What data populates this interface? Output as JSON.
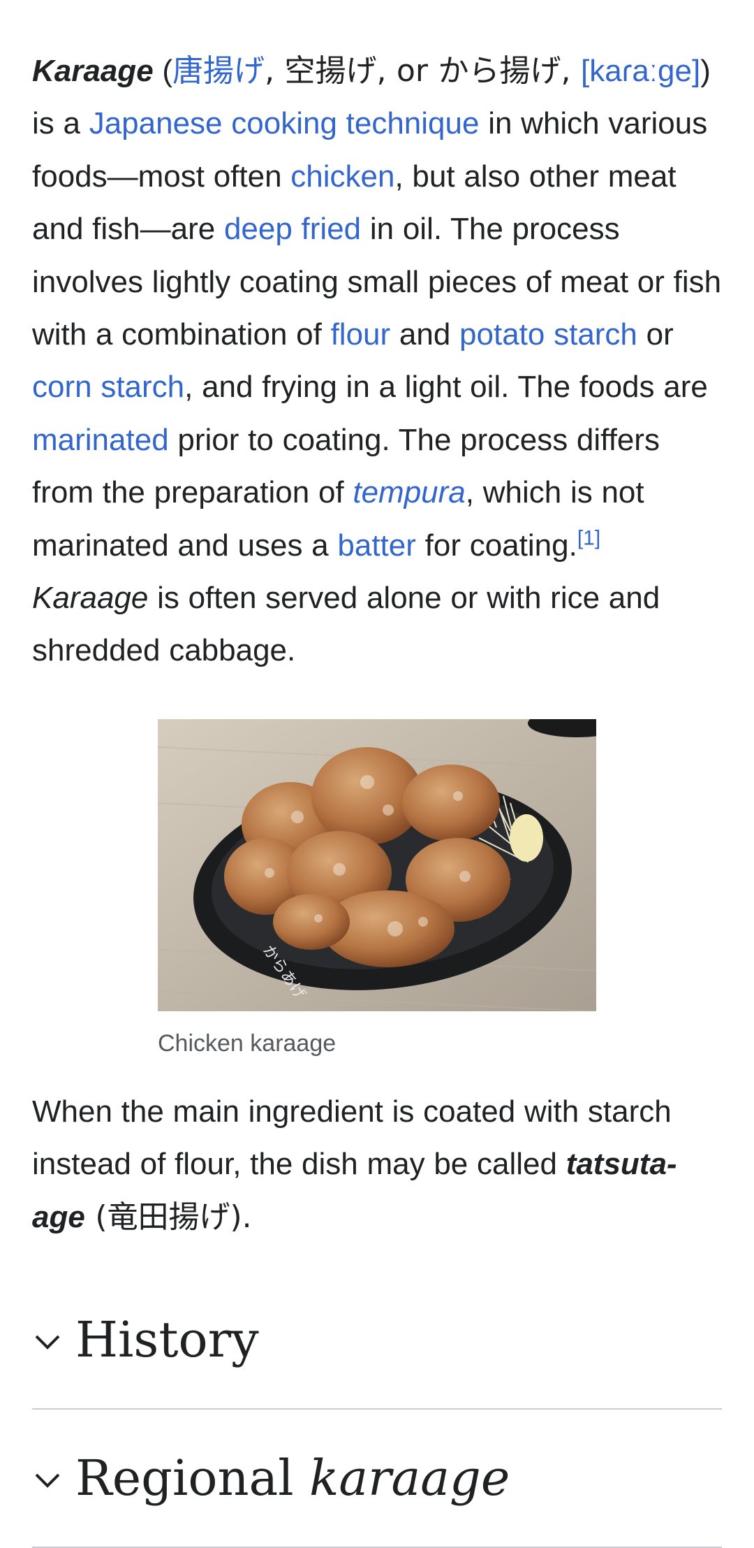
{
  "intro": {
    "term": "Karaage",
    "open_paren": " (",
    "kanji_link": "唐揚げ",
    "alt_spellings": ", 空揚げ, or から揚げ, ",
    "ipa_link": "[kaɾaːge]",
    "close": ") is a ",
    "link_technique": "Japanese cooking technique",
    "t1": " in which various foods—most often ",
    "link_chicken": "chicken",
    "t2": ", but also other meat and fish—are ",
    "link_deep_fried": "deep fried",
    "t3": " in oil. The process involves lightly coating small pieces of meat or fish with a combination of ",
    "link_flour": "flour",
    "t4": " and ",
    "link_potato_starch": "potato starch",
    "t5": " or ",
    "link_corn_starch": "corn starch",
    "t6": ", and frying in a light oil. The foods are ",
    "link_marinated": "marinated",
    "t7": " prior to coating. The process differs from the preparation of ",
    "link_tempura": "tempura",
    "t8": ", which is not marinated and uses a ",
    "link_batter": "batter",
    "t9": " for coating.",
    "ref": "[1]",
    "t10_space": " ",
    "term2": "Karaage",
    "t11": " is often served alone or with rice and shredded cabbage."
  },
  "figure": {
    "caption": "Chicken karaage",
    "plate_text": "からあげ"
  },
  "tatsuta": {
    "t1": "When the main ingredient is coated with starch instead of flour, the dish may be called ",
    "term": "tatsuta-age",
    "t2": " (竜田揚げ)."
  },
  "sections": {
    "history": "History",
    "regional_prefix": "Regional ",
    "regional_term": "karaage"
  }
}
